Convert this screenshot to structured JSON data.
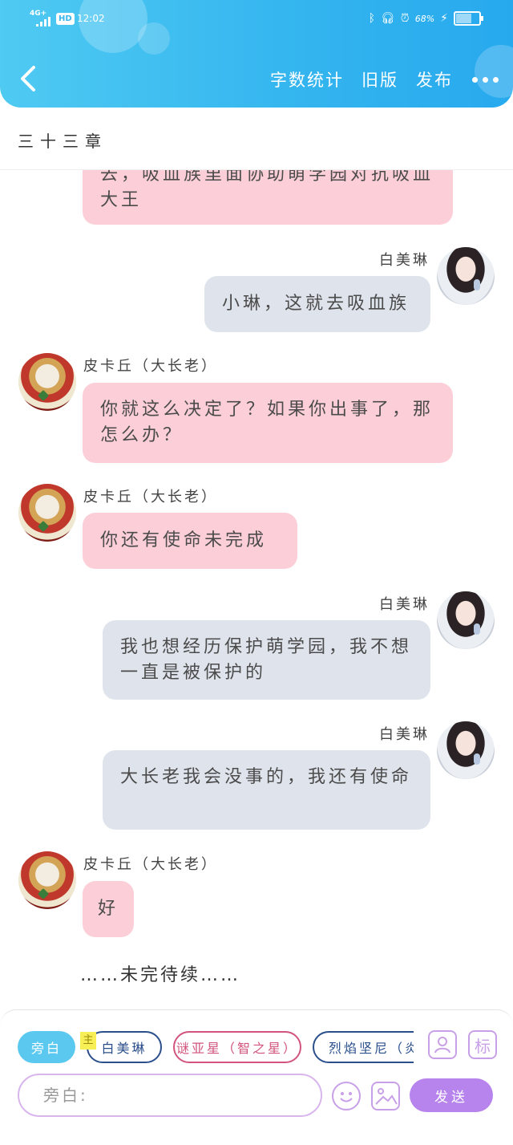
{
  "status_bar": {
    "network": "4G+",
    "hd": "HD",
    "time": "12:02",
    "battery_pct": "68%",
    "battery_level": 0.68
  },
  "nav": {
    "word_count": "字数统计",
    "old_version": "旧版",
    "publish": "发布"
  },
  "chapter": {
    "title": "三十三章"
  },
  "messages": [
    {
      "speaker": "",
      "text": "去，吸血族里面协助萌学园对抗吸血大王"
    },
    {
      "speaker": "白美琳",
      "text": "小琳，这就去吸血族"
    },
    {
      "speaker": "皮卡丘（大长老）",
      "text": "你就这么决定了？如果你出事了，那怎么办？"
    },
    {
      "speaker": "皮卡丘（大长老）",
      "text": "你还有使命未完成"
    },
    {
      "speaker": "白美琳",
      "text": "我也想经历保护萌学园，我不想一直是被保护的"
    },
    {
      "speaker": "白美琳",
      "text": "大长老我会没事的，我还有使命"
    },
    {
      "speaker": "皮卡丘（大长老）",
      "text": "好"
    }
  ],
  "to_be_continued": "……未完待续……",
  "composer": {
    "roles": [
      "旁白",
      "白美琳",
      "谜亚星（智之星）",
      "烈焰坚尼（炎之"
    ],
    "main_tag": "主",
    "tag_button": "标",
    "input_placeholder": "旁白:",
    "send": "发送"
  }
}
